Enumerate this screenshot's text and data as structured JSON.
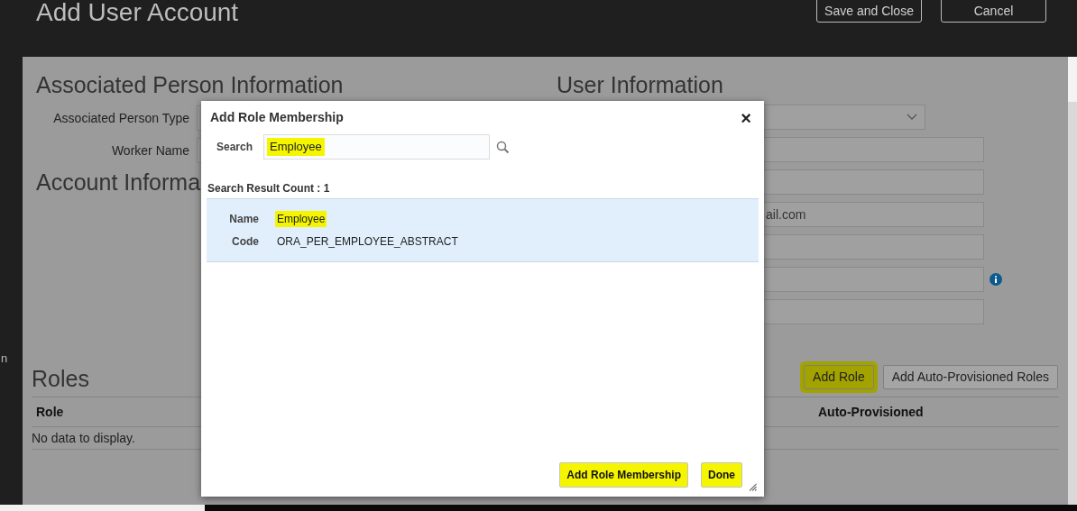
{
  "header": {
    "title": "Add User Account",
    "buttons": [
      {
        "label": "Save and Close"
      },
      {
        "label": "Cancel"
      }
    ]
  },
  "edge_text": "n",
  "person_info": {
    "title": "Associated Person Information",
    "fields": [
      {
        "label": "Associated Person Type"
      },
      {
        "label": "Worker Name"
      }
    ]
  },
  "account_info": {
    "title": "Account Informa"
  },
  "user_info": {
    "title": "User Information",
    "fields": [
      {
        "kind": "select"
      },
      {
        "kind": "text"
      },
      {
        "kind": "text"
      },
      {
        "kind": "text",
        "value": "ail.com"
      },
      {
        "kind": "text"
      },
      {
        "kind": "text_info"
      },
      {
        "kind": "text"
      }
    ]
  },
  "roles": {
    "title": "Roles",
    "buttons": [
      {
        "label": "Add Role",
        "highlighted": true
      },
      {
        "label": "Add Auto-Provisioned Roles",
        "highlighted": false
      }
    ],
    "columns": [
      "Role",
      "Auto-Provisioned"
    ],
    "empty_text": "No data to display."
  },
  "dialog": {
    "title": "Add Role Membership",
    "close": "×",
    "search": {
      "label": "Search",
      "value": "Employee",
      "highlighted": true
    },
    "result_count": "Search Result Count : 1",
    "results": [
      {
        "selected": true,
        "fields": [
          {
            "label": "Name",
            "value": "Employee",
            "highlighted": true
          },
          {
            "label": "Code",
            "value": "ORA_PER_EMPLOYEE_ABSTRACT",
            "highlighted": false
          }
        ]
      }
    ],
    "buttons": [
      {
        "label": "Add Role Membership",
        "highlighted": true
      },
      {
        "label": "Done",
        "highlighted": true
      }
    ]
  }
}
